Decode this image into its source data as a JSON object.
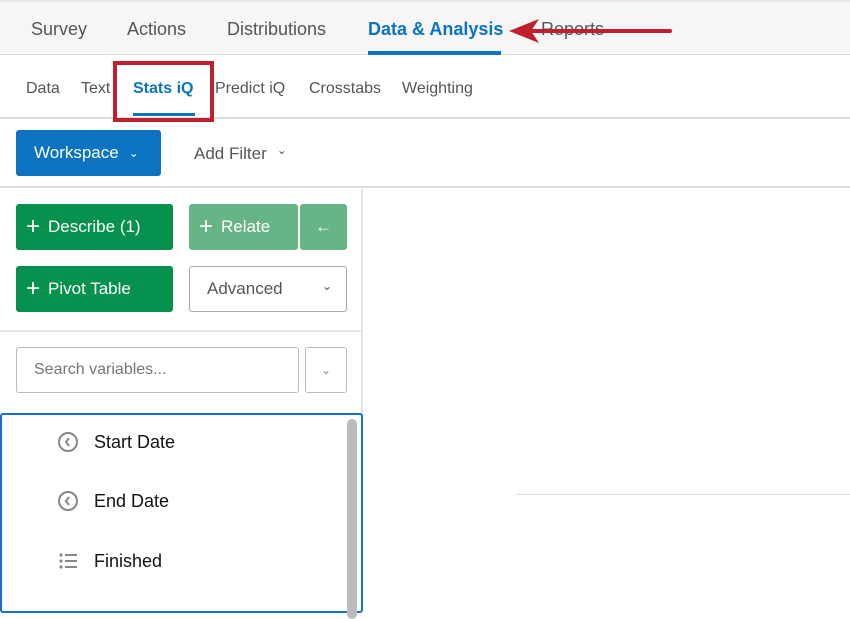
{
  "top_tabs": [
    "Survey",
    "Actions",
    "Distributions",
    "Data & Analysis",
    "Reports"
  ],
  "active_top_tab": "Data & Analysis",
  "sub_tabs": [
    "Data",
    "Text",
    "Stats iQ",
    "Predict iQ",
    "Crosstabs",
    "Weighting"
  ],
  "active_sub_tab": "Stats iQ",
  "toolbar": {
    "workspace_label": "Workspace",
    "add_filter_label": "Add Filter"
  },
  "actions": {
    "describe_label": "Describe (1)",
    "relate_label": "Relate",
    "pivot_label": "Pivot Table",
    "advanced_label": "Advanced"
  },
  "search": {
    "placeholder": "Search variables..."
  },
  "variables": [
    {
      "label": "Start Date",
      "icon": "clock-icon"
    },
    {
      "label": "End Date",
      "icon": "clock-icon"
    },
    {
      "label": "Finished",
      "icon": "list-icon"
    }
  ],
  "colors": {
    "accent": "#0b73c2",
    "green": "#06914f",
    "annotation": "#c0202e"
  }
}
